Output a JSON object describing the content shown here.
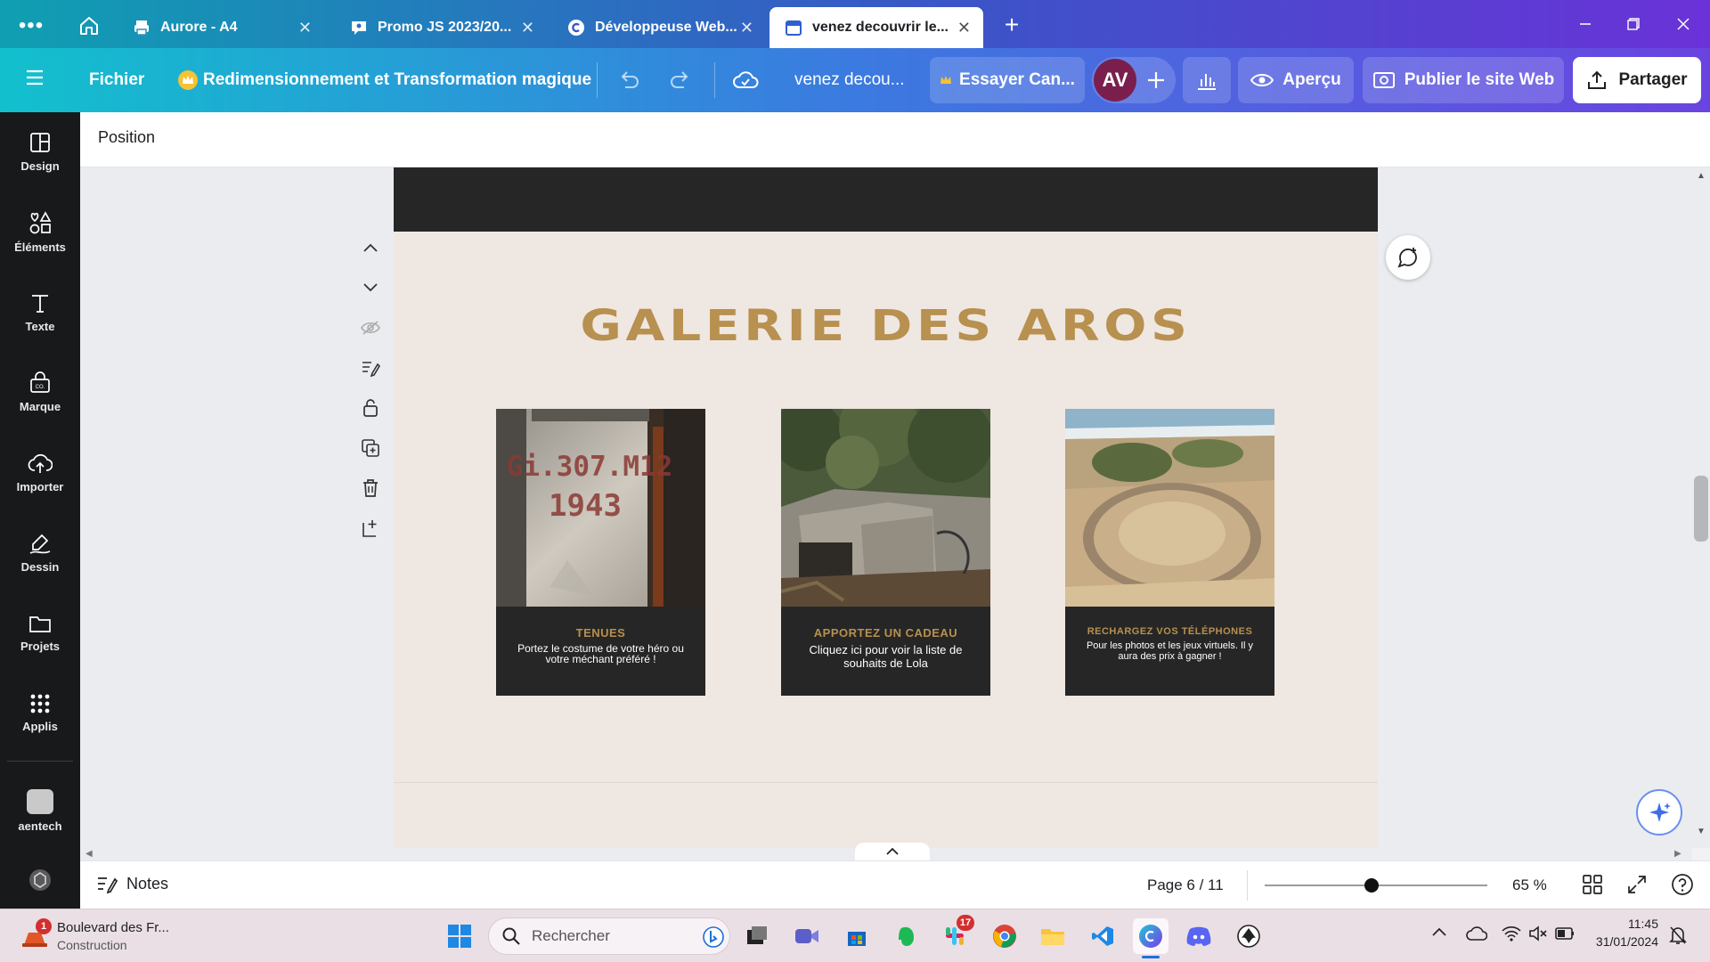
{
  "browser": {
    "tabs": [
      {
        "title": "Aurore - A4"
      },
      {
        "title": "Promo JS 2023/20..."
      },
      {
        "title": "Développeuse Web..."
      },
      {
        "title": "venez decouvrir le..."
      }
    ],
    "new_tab": "+",
    "close_glyph": "✕"
  },
  "toolbar": {
    "menu": "Fichier",
    "resize": "Redimensionnement et Transformation magique",
    "doc_title": "venez decou...",
    "try_pro": "Essayer Can...",
    "avatar": "AV",
    "preview": "Aperçu",
    "publish": "Publier le site Web",
    "share": "Partager"
  },
  "sidebar": {
    "items": [
      {
        "label": "Design",
        "icon": "layout-icon"
      },
      {
        "label": "Éléments",
        "icon": "shapes-icon"
      },
      {
        "label": "Texte",
        "icon": "text-icon"
      },
      {
        "label": "Marque",
        "icon": "brand-icon"
      },
      {
        "label": "Importer",
        "icon": "cloud-upload-icon"
      },
      {
        "label": "Dessin",
        "icon": "draw-icon"
      },
      {
        "label": "Projets",
        "icon": "folder-icon"
      },
      {
        "label": "Applis",
        "icon": "apps-grid-icon"
      },
      {
        "label": "aentech",
        "icon": "app-avatar-icon"
      }
    ]
  },
  "position_bar": {
    "label": "Position"
  },
  "page": {
    "heading": "GALERIE DES AROS",
    "cards": [
      {
        "title": "TENUES",
        "body": "Portez le costume de votre héro ou votre méchant préféré !",
        "stencil1": "Gi.307.M12",
        "stencil2": "1943"
      },
      {
        "title": "APPORTEZ UN CADEAU",
        "body": "Cliquez ici pour voir la liste de souhaits de Lola"
      },
      {
        "title": "RECHARGEZ VOS TÉLÉPHONES",
        "body": "Pour les photos et les jeux virtuels. Il y aura des prix à gagner !"
      }
    ]
  },
  "bottom_bar": {
    "notes": "Notes",
    "page_indicator": "Page 6 / 11",
    "zoom": "65 %",
    "zoom_fraction": 0.48
  },
  "taskbar": {
    "notification_badge": "1",
    "widget_title": "Boulevard des Fr...",
    "widget_subtitle": "Construction",
    "search_placeholder": "Rechercher",
    "slack_badge": "17",
    "time": "11:45",
    "date": "31/01/2024"
  },
  "colors": {
    "gold": "#b8904f",
    "card_dark": "#262626",
    "page_bg": "#efe7e1",
    "avatar": "#7a1f4d"
  }
}
